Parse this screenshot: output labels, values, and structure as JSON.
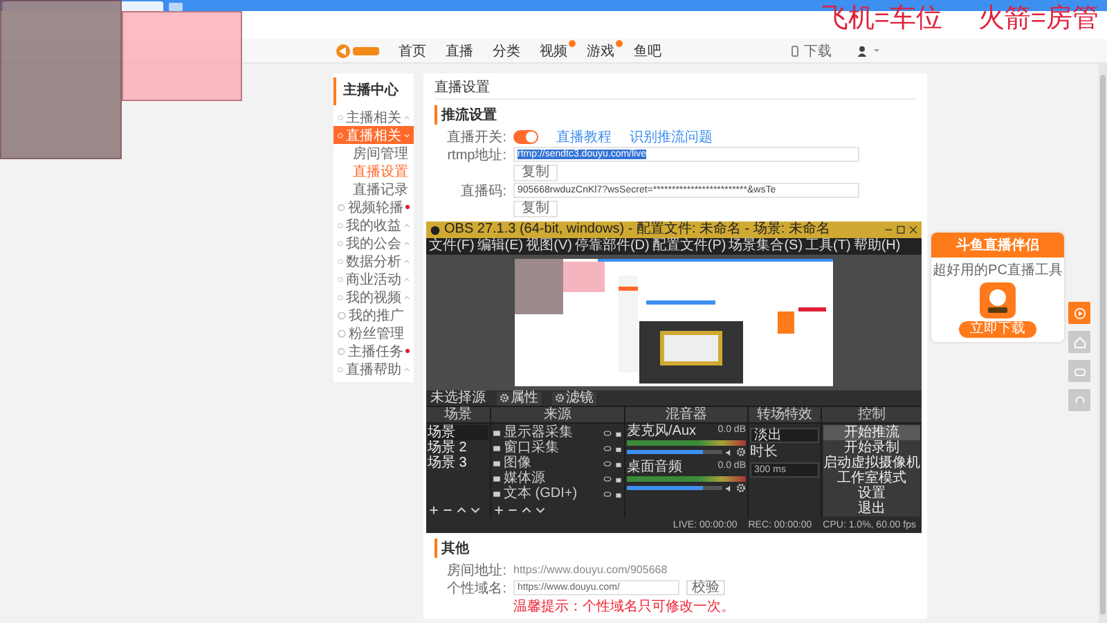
{
  "overlay_texts": [
    "飞机=车位",
    "火箭=房管"
  ],
  "nav": {
    "items": [
      {
        "label": "首页",
        "badge": false
      },
      {
        "label": "直播",
        "badge": false
      },
      {
        "label": "分类",
        "badge": false
      },
      {
        "label": "视频",
        "badge": true
      },
      {
        "label": "游戏",
        "badge": true
      },
      {
        "label": "鱼吧",
        "badge": false
      }
    ],
    "download": "下载"
  },
  "sidebar": {
    "title": "主播中心",
    "items": [
      {
        "label": "主播相关",
        "kind": "group",
        "expanded": false,
        "selected": false,
        "dot": false
      },
      {
        "label": "直播相关",
        "kind": "group",
        "expanded": true,
        "selected": true,
        "dot": false,
        "children": [
          {
            "label": "房间管理",
            "selected": false
          },
          {
            "label": "直播设置",
            "selected": true
          },
          {
            "label": "直播记录",
            "selected": false
          }
        ]
      },
      {
        "label": "视频轮播",
        "kind": "link",
        "selected": false,
        "dot": true
      },
      {
        "label": "我的收益",
        "kind": "group",
        "expanded": false,
        "selected": false,
        "dot": false
      },
      {
        "label": "我的公会",
        "kind": "group",
        "expanded": false,
        "selected": false,
        "dot": false
      },
      {
        "label": "数据分析",
        "kind": "group",
        "expanded": false,
        "selected": false,
        "dot": false
      },
      {
        "label": "商业活动",
        "kind": "group",
        "expanded": false,
        "selected": false,
        "dot": false
      },
      {
        "label": "我的视频",
        "kind": "group",
        "expanded": false,
        "selected": false,
        "dot": false
      },
      {
        "label": "我的推广",
        "kind": "link",
        "selected": false,
        "dot": false
      },
      {
        "label": "粉丝管理",
        "kind": "link",
        "selected": false,
        "dot": false
      },
      {
        "label": "主播任务",
        "kind": "link",
        "selected": false,
        "dot": true
      },
      {
        "label": "直播帮助",
        "kind": "group",
        "expanded": false,
        "selected": false,
        "dot": false
      }
    ]
  },
  "main": {
    "title": "直播设置",
    "section": "推流设置",
    "stream_switch": {
      "label": "直播开关:",
      "on": true
    },
    "links": [
      "直播教程",
      "识别推流问题"
    ],
    "rtmp": {
      "label": "rtmp地址:",
      "value": "rtmp://sendtc3.douyu.com/live",
      "selected": true,
      "copy": "复制"
    },
    "code": {
      "label": "直播码:",
      "value": "905668rwduzCnKl7?wsSecret=*************************&wsTe",
      "selected": false,
      "copy": "复制"
    },
    "other": {
      "title": "其他",
      "room": {
        "label": "房间地址:",
        "value": "https://www.douyu.com/905668"
      },
      "domain": {
        "label": "个性域名:",
        "value": "https://www.douyu.com/",
        "button": "校验",
        "hint": "温馨提示：个性域名只可修改一次。"
      }
    }
  },
  "obs": {
    "title": "OBS 27.1.3 (64-bit, windows) - 配置文件: 未命名 - 场景: 未命名",
    "menu": [
      "文件(F)",
      "编辑(E)",
      "视图(V)",
      "停靠部件(D)",
      "配置文件(P)",
      "场景集合(S)",
      "工具(T)",
      "帮助(H)"
    ],
    "context": {
      "label": "未选择源",
      "buttons": [
        "属性",
        "滤镜"
      ]
    },
    "docks": [
      "场景",
      "来源",
      "混音器",
      "转场特效",
      "控制"
    ],
    "scenes": [
      {
        "name": "场景",
        "selected": true
      },
      {
        "name": "场景 2",
        "selected": false
      },
      {
        "name": "场景 3",
        "selected": false
      }
    ],
    "sources": [
      "显示器采集",
      "窗口采集",
      "图像",
      "媒体源",
      "文本 (GDI+)"
    ],
    "mixer": [
      {
        "name": "麦克风/Aux",
        "db": "0.0 dB",
        "level": 0.8
      },
      {
        "name": "桌面音频",
        "db": "0.0 dB",
        "level": 0.8
      }
    ],
    "transition": {
      "value": "淡出",
      "duration_label": "时长",
      "duration": "300 ms"
    },
    "controls": [
      {
        "label": "开始推流",
        "selected": true
      },
      {
        "label": "开始录制",
        "selected": false
      },
      {
        "label": "启动虚拟摄像机",
        "selected": false
      },
      {
        "label": "工作室模式",
        "selected": false
      },
      {
        "label": "设置",
        "selected": false
      },
      {
        "label": "退出",
        "selected": false
      }
    ],
    "status": [
      "LIVE: 00:00:00",
      "REC: 00:00:00",
      "CPU: 1.0%, 60.00 fps"
    ]
  },
  "promo": {
    "title": "斗鱼直播伴侣",
    "subtitle": "超好用的PC直播工具",
    "button": "立即下载"
  }
}
